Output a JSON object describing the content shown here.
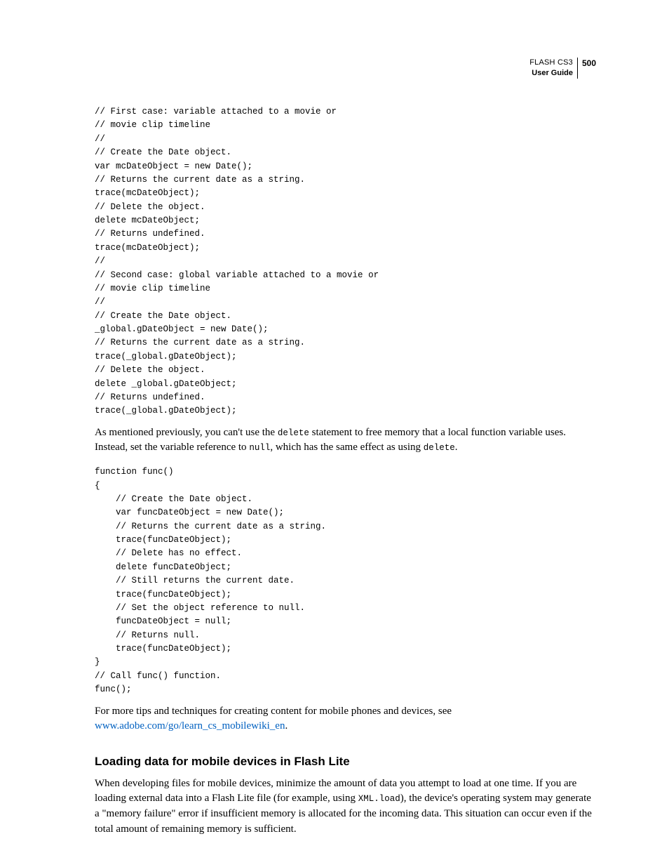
{
  "header": {
    "product": "FLASH CS3",
    "guide": "User Guide",
    "page": "500"
  },
  "code1": "// First case: variable attached to a movie or\n// movie clip timeline\n//\n// Create the Date object.\nvar mcDateObject = new Date();\n// Returns the current date as a string.\ntrace(mcDateObject);\n// Delete the object.\ndelete mcDateObject;\n// Returns undefined.\ntrace(mcDateObject);\n//\n// Second case: global variable attached to a movie or\n// movie clip timeline\n//\n// Create the Date object.\n_global.gDateObject = new Date();\n// Returns the current date as a string.\ntrace(_global.gDateObject);\n// Delete the object.\ndelete _global.gDateObject;\n// Returns undefined.\ntrace(_global.gDateObject);",
  "para1": {
    "t1": "As mentioned previously, you can't use the ",
    "c1": "delete",
    "t2": " statement to free memory that a local function variable uses. Instead, set the variable reference to ",
    "c2": "null",
    "t3": ", which has the same effect as using ",
    "c3": "delete",
    "t4": "."
  },
  "code2": "function func()\n{\n    // Create the Date object.\n    var funcDateObject = new Date();\n    // Returns the current date as a string.\n    trace(funcDateObject);\n    // Delete has no effect.\n    delete funcDateObject;\n    // Still returns the current date.\n    trace(funcDateObject);\n    // Set the object reference to null.\n    funcDateObject = null;\n    // Returns null.\n    trace(funcDateObject);\n}\n// Call func() function.\nfunc();",
  "para2": {
    "t1": "For more tips and techniques for creating content for mobile phones and devices, see ",
    "link": "www.adobe.com/go/learn_cs_mobilewiki_en",
    "t2": "."
  },
  "section_heading": "Loading data for mobile devices in Flash Lite",
  "para3": {
    "t1": "When developing files for mobile devices, minimize the amount of data you attempt to load at one time. If you are loading external data into a Flash Lite file (for example, using ",
    "c1": "XML.load",
    "t2": "), the device's operating system may generate a \"memory failure\" error if insufficient memory is allocated for the incoming data. This situation can occur even if the total amount of remaining memory is sufficient."
  }
}
